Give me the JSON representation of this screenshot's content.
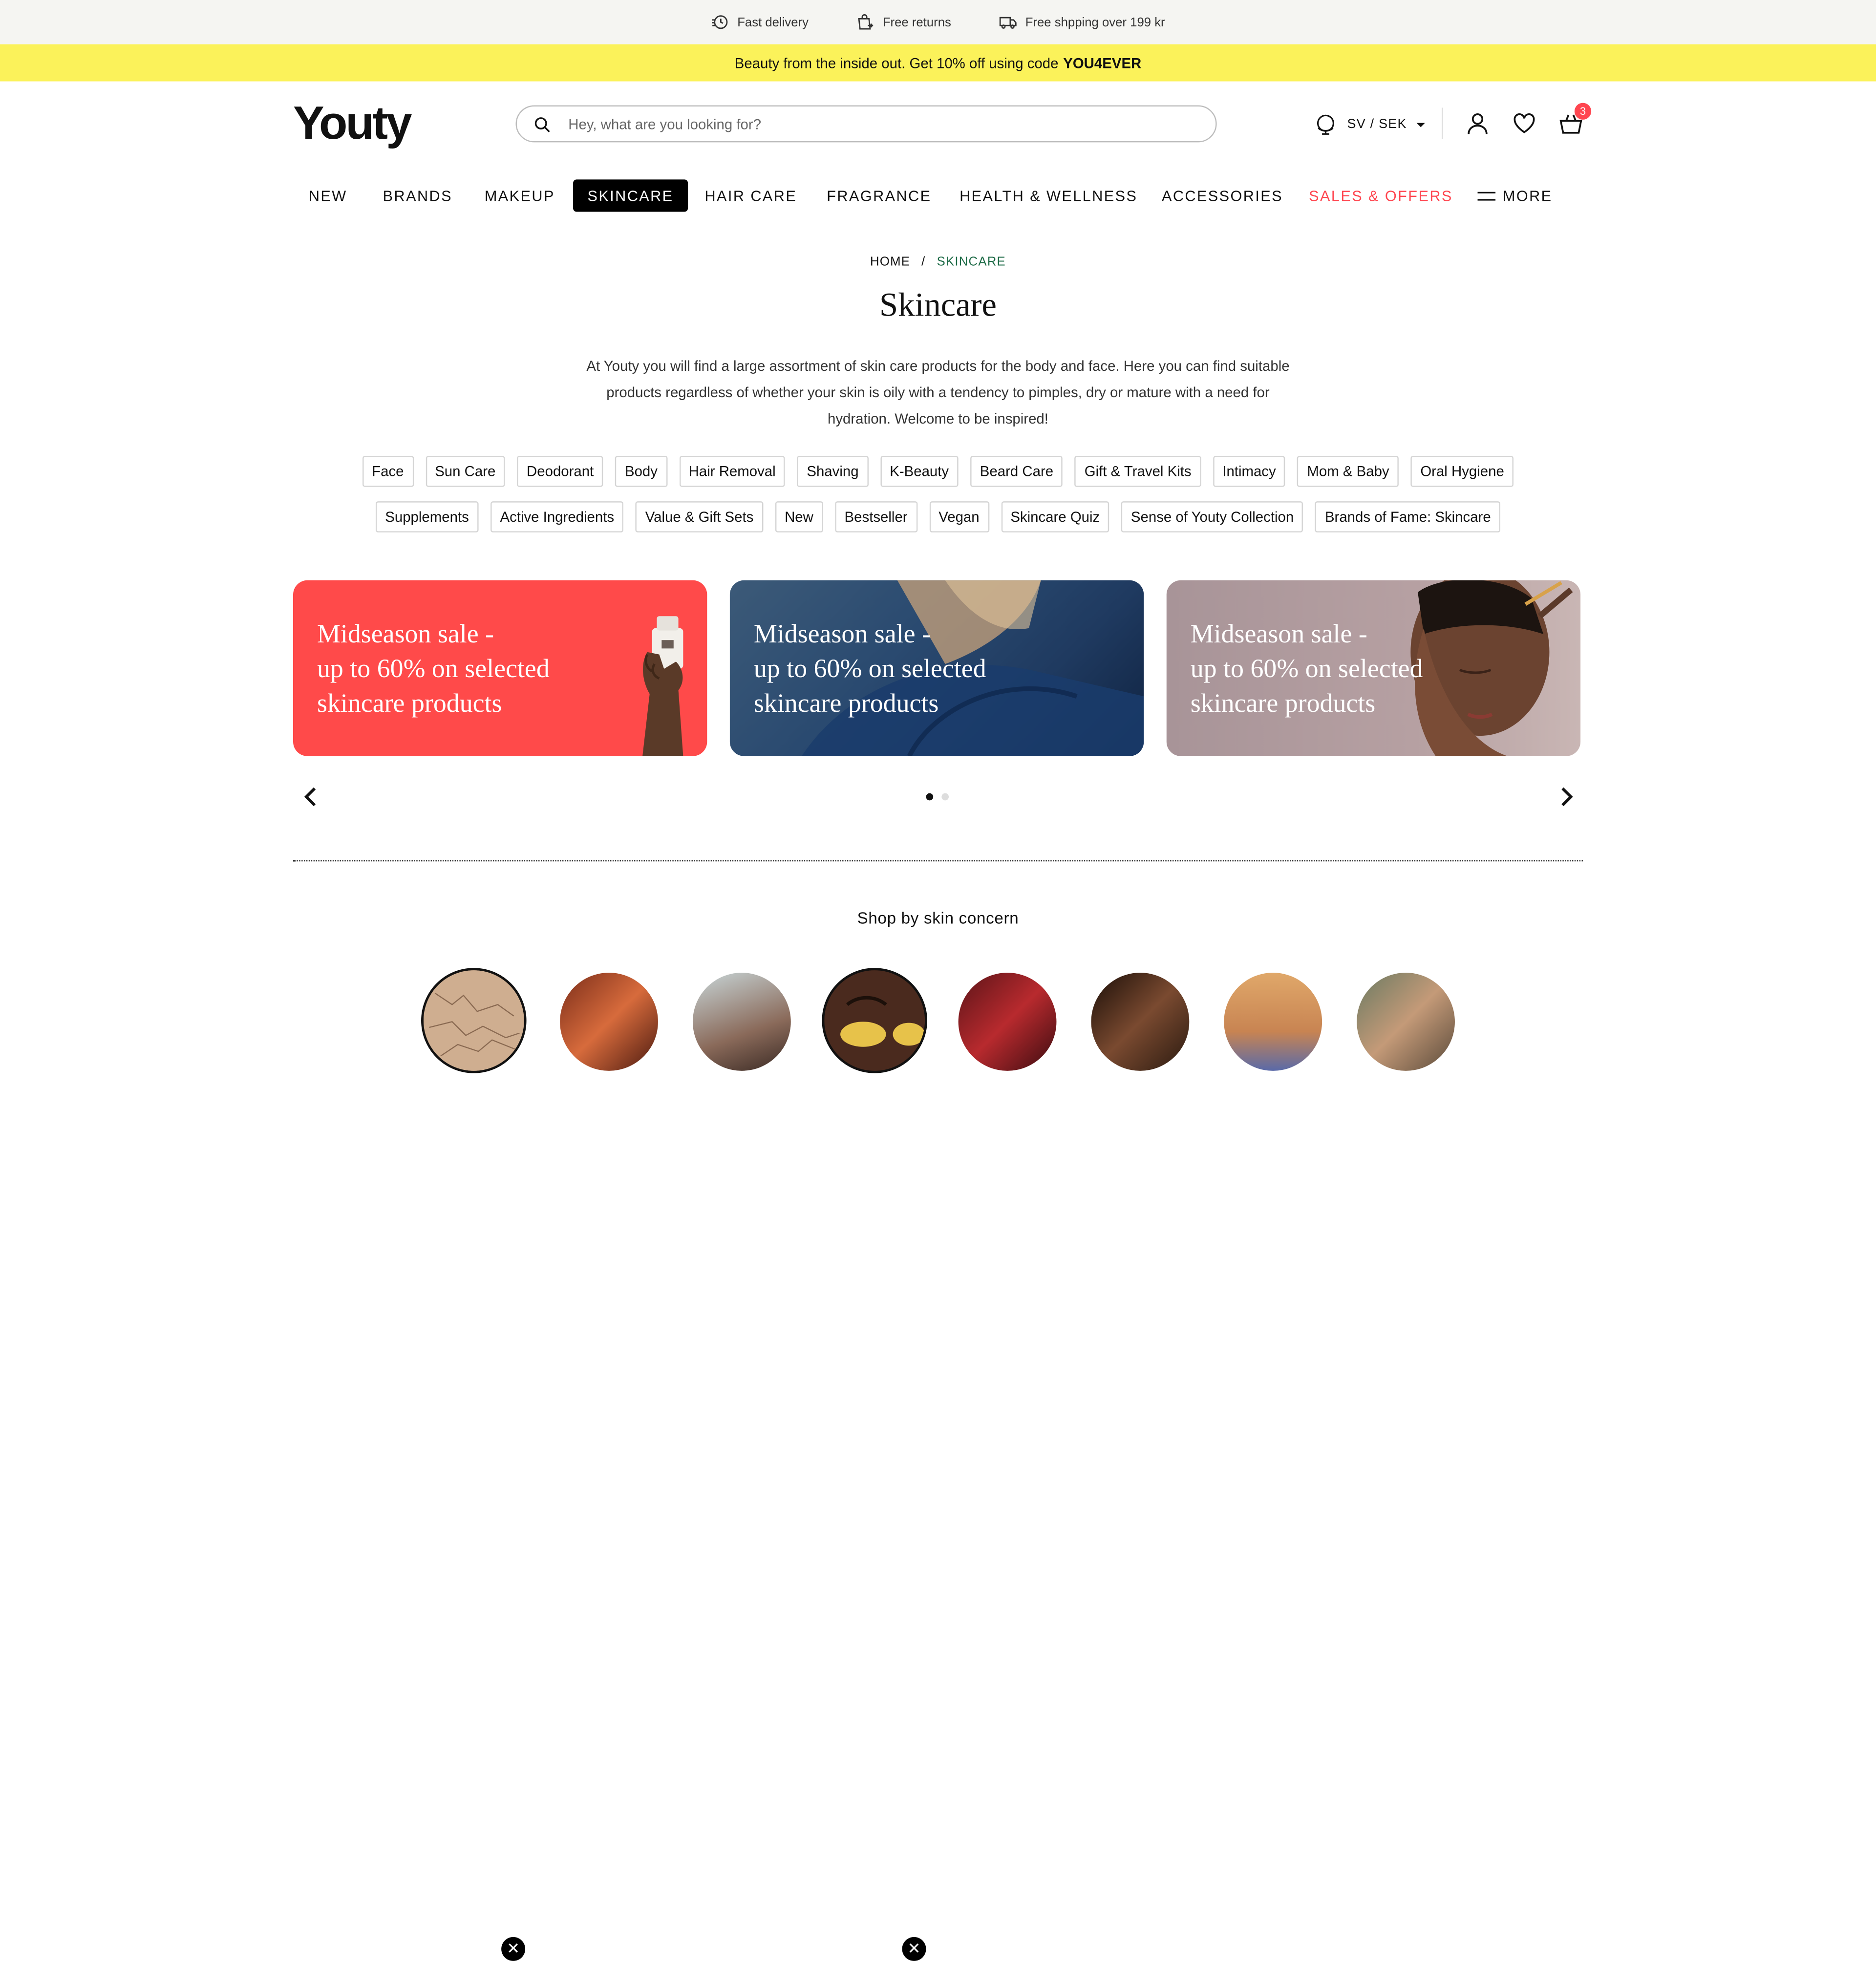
{
  "utility": {
    "items": [
      {
        "icon": "clock-delivery-icon",
        "label": "Fast delivery"
      },
      {
        "icon": "bag-return-icon",
        "label": "Free returns"
      },
      {
        "icon": "truck-icon",
        "label": "Free shpping over 199 kr"
      }
    ]
  },
  "promo": {
    "text": "Beauty from the inside out. Get 10% off using code",
    "code": "YOU4EVER"
  },
  "header": {
    "logo": "Youty",
    "search_placeholder": "Hey, what are you looking for?",
    "locale": "SV / SEK",
    "cart_count": "3"
  },
  "nav": {
    "items": [
      {
        "label": "NEW"
      },
      {
        "label": "BRANDS"
      },
      {
        "label": "MAKEUP"
      },
      {
        "label": "SKINCARE",
        "active": true
      },
      {
        "label": "HAIR CARE"
      },
      {
        "label": "FRAGRANCE"
      },
      {
        "label": "HEALTH & WELLNESS"
      },
      {
        "label": "ACCESSORIES"
      },
      {
        "label": "SALES & OFFERS",
        "sale": true
      },
      {
        "label": "MORE"
      }
    ]
  },
  "breadcrumb": {
    "home": "HOME",
    "separator": "/",
    "current": "SKINCARE"
  },
  "page": {
    "title": "Skincare",
    "description": "At Youty you will find a large assortment of skin care products for the body and face. Here you can find suitable products regardless of whether your skin is oily with a tendency to pimples, dry or mature with a need for hydration. Welcome to be inspired!"
  },
  "chips": {
    "row1": [
      "Face",
      "Sun Care",
      "Deodorant",
      "Body",
      "Hair Removal",
      "Shaving",
      "K-Beauty",
      "Beard Care",
      "Gift & Travel Kits",
      "Intimacy",
      "Mom & Baby",
      "Oral Hygiene"
    ],
    "row2": [
      "Supplements",
      "Active Ingredients",
      "Value & Gift Sets",
      "New",
      "Bestseller",
      "Vegan",
      "Skincare Quiz",
      "Sense of Youty Collection",
      "Brands of Fame: Skincare"
    ]
  },
  "banners": [
    {
      "line1": "Midseason sale -",
      "line2": "up to 60% on selected",
      "line3": "skincare products",
      "color": "#ff4a4a"
    },
    {
      "line1": "Midseason sale -",
      "line2": "up to 60% on selected",
      "line3": "skincare products",
      "color": "#2a4a70"
    },
    {
      "line1": "Midseason sale -",
      "line2": "up to 60% on selected",
      "line3": "skincare products",
      "color": "#b6a0a2"
    }
  ],
  "carousel": {
    "active_dot": 1,
    "dot_count": 2
  },
  "concerns": {
    "title": "Shop by skin concern",
    "items": [
      {
        "name": "dry-skin",
        "selected": true
      },
      {
        "name": "texture",
        "selected": false
      },
      {
        "name": "blemish",
        "selected": false
      },
      {
        "name": "eye-area",
        "selected": true
      },
      {
        "name": "redness",
        "selected": false
      },
      {
        "name": "dark-skin-hands",
        "selected": false
      },
      {
        "name": "oil-serum",
        "selected": false
      },
      {
        "name": "mature-skin",
        "selected": false
      }
    ]
  },
  "colors": {
    "accent_sale": "#ff4650",
    "promo_bg": "#fbf25a",
    "breadcrumb_current": "#1e6b47"
  }
}
